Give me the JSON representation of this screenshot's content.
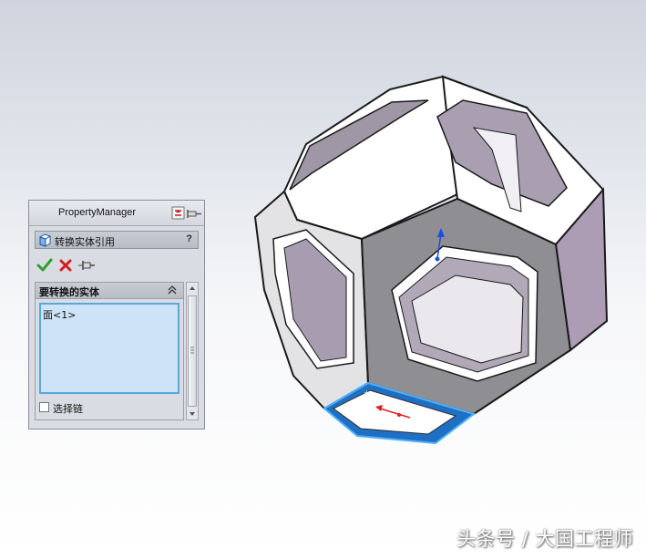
{
  "property_manager": {
    "title": "PropertyManager",
    "feature": {
      "label": "转换实体引用",
      "help": "?"
    },
    "actions": {
      "ok_icon": "checkmark-icon",
      "cancel_icon": "x-icon",
      "pin_icon": "pushpin-icon"
    },
    "group": {
      "label": "要转换的实体",
      "selection_items": [
        "面<1>"
      ],
      "select_chain_label": "选择链",
      "select_chain_checked": false
    }
  },
  "model": {
    "name": "truncated-octahedron-frame",
    "selected_face_color": "#2f8fe0",
    "face_light": "#ffffff",
    "face_shadow": "#b4a9b9",
    "face_dark": "#8d8b92"
  },
  "watermark": "头条号 / 大国工程师"
}
